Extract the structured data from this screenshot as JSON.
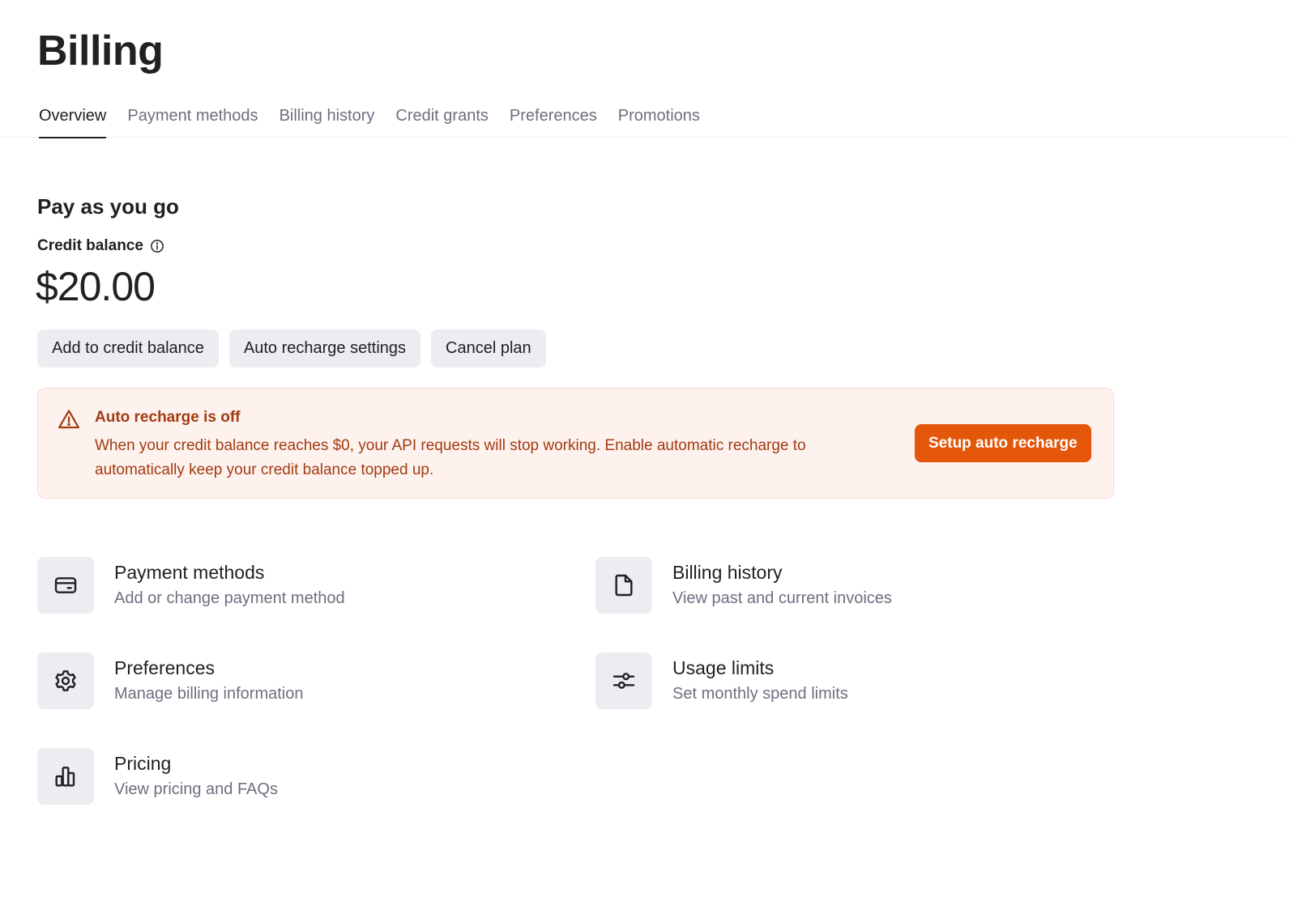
{
  "page": {
    "title": "Billing"
  },
  "tabs": [
    {
      "label": "Overview",
      "active": true
    },
    {
      "label": "Payment methods",
      "active": false
    },
    {
      "label": "Billing history",
      "active": false
    },
    {
      "label": "Credit grants",
      "active": false
    },
    {
      "label": "Preferences",
      "active": false
    },
    {
      "label": "Promotions",
      "active": false
    }
  ],
  "plan": {
    "title": "Pay as you go",
    "balance_label": "Credit balance",
    "balance_amount": "$20.00",
    "info_icon": "info-circle-icon"
  },
  "actions": {
    "add_credit": "Add to credit balance",
    "auto_recharge_settings": "Auto recharge settings",
    "cancel_plan": "Cancel plan"
  },
  "alert": {
    "icon": "warning-triangle-icon",
    "title": "Auto recharge is off",
    "text": "When your credit balance reaches $0, your API requests will stop working. Enable automatic recharge to automatically keep your credit balance topped up.",
    "button": "Setup auto recharge",
    "accent_color": "#e4560a",
    "text_color": "#a13b12",
    "background_color": "#fef2ee"
  },
  "links": {
    "payment_methods": {
      "title": "Payment methods",
      "description": "Add or change payment method",
      "icon": "credit-card-icon"
    },
    "billing_history": {
      "title": "Billing history",
      "description": "View past and current invoices",
      "icon": "document-icon"
    },
    "preferences": {
      "title": "Preferences",
      "description": "Manage billing information",
      "icon": "gear-icon"
    },
    "usage_limits": {
      "title": "Usage limits",
      "description": "Set monthly spend limits",
      "icon": "sliders-icon"
    },
    "pricing": {
      "title": "Pricing",
      "description": "View pricing and FAQs",
      "icon": "bar-chart-icon"
    }
  }
}
